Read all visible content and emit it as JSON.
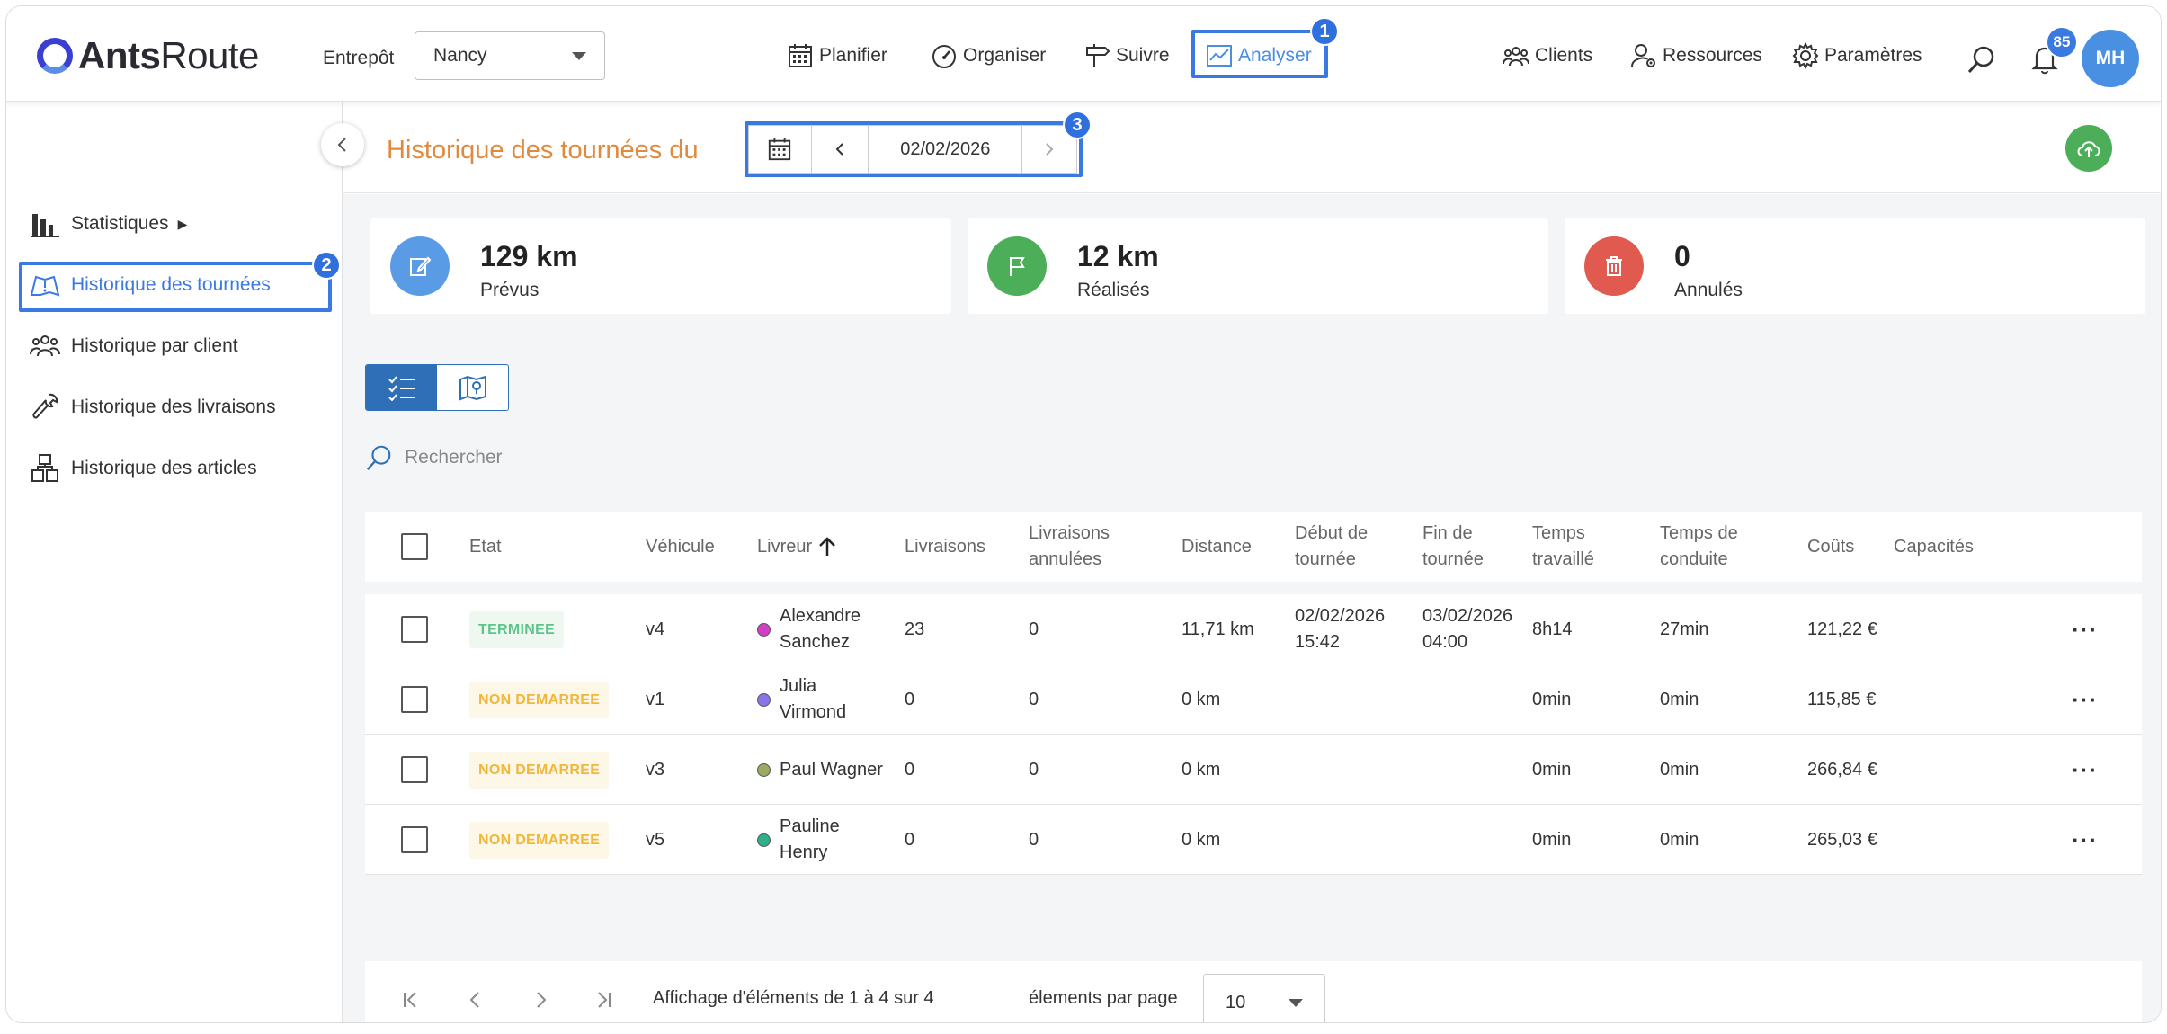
{
  "app": {
    "brand_bold": "Ants",
    "brand_light": "Route"
  },
  "header": {
    "entrepot_label": "Entrepôt",
    "entrepot_value": "Nancy",
    "nav": [
      {
        "label": "Planifier",
        "icon": "calendar-icon"
      },
      {
        "label": "Organiser",
        "icon": "speedometer-icon"
      },
      {
        "label": "Suivre",
        "icon": "signpost-icon"
      },
      {
        "label": "Analyser",
        "icon": "chart-icon",
        "active": true
      }
    ],
    "right_nav": [
      {
        "label": "Clients",
        "icon": "users-icon"
      },
      {
        "label": "Ressources",
        "icon": "user-gear-icon"
      },
      {
        "label": "Paramètres",
        "icon": "gear-icon"
      }
    ],
    "notification_count": "85",
    "avatar_initials": "MH"
  },
  "annotations": {
    "one": "1",
    "two": "2",
    "three": "3"
  },
  "sidebar": {
    "items": [
      {
        "label": "Statistiques",
        "icon": "bar-chart-icon",
        "suffix": "▶"
      },
      {
        "label": "Historique des tournées",
        "icon": "map-icon",
        "active": true
      },
      {
        "label": "Historique par client",
        "icon": "users-icon"
      },
      {
        "label": "Historique des livraisons",
        "icon": "wrench-icon"
      },
      {
        "label": "Historique des articles",
        "icon": "boxes-icon"
      }
    ]
  },
  "page": {
    "title": "Historique des tournées du",
    "date": "02/02/2026"
  },
  "stats": [
    {
      "value": "129 km",
      "label": "Prévus",
      "color": "#5a9be6"
    },
    {
      "value": "12 km",
      "label": "Réalisés",
      "color": "#4cae58"
    },
    {
      "value": "0",
      "label": "Annulés",
      "color": "#e05a4f"
    }
  ],
  "search": {
    "placeholder": "Rechercher"
  },
  "table": {
    "headers": {
      "etat": "Etat",
      "vehicule": "Véhicule",
      "livreur": "Livreur",
      "livraisons": "Livraisons",
      "livraisons_annulees_1": "Livraisons",
      "livraisons_annulees_2": "annulées",
      "distance": "Distance",
      "debut_1": "Début de",
      "debut_2": "tournée",
      "fin_1": "Fin de",
      "fin_2": "tournée",
      "temps_travaille_1": "Temps",
      "temps_travaille_2": "travaillé",
      "temps_conduite_1": "Temps de",
      "temps_conduite_2": "conduite",
      "couts": "Coûts",
      "capacites": "Capacités"
    },
    "rows": [
      {
        "etat": "TERMINEE",
        "vehicule": "v4",
        "livreur_1": "Alexandre",
        "livreur_2": "Sanchez",
        "dot_color": "#d13fc9",
        "livraisons": "23",
        "annulees": "0",
        "distance": "11,71 km",
        "debut_1": "02/02/2026",
        "debut_2": "15:42",
        "fin_1": "03/02/2026",
        "fin_2": "04:00",
        "temps_travaille": "8h14",
        "temps_conduite": "27min",
        "couts": "121,22 €",
        "actions": "···"
      },
      {
        "etat": "NON DEMARREE",
        "vehicule": "v1",
        "livreur_1": "Julia",
        "livreur_2": "Virmond",
        "dot_color": "#8a74e8",
        "livraisons": "0",
        "annulees": "0",
        "distance": "0 km",
        "debut_1": "",
        "debut_2": "",
        "fin_1": "",
        "fin_2": "",
        "temps_travaille": "0min",
        "temps_conduite": "0min",
        "couts": "115,85 €",
        "actions": "···"
      },
      {
        "etat": "NON DEMARREE",
        "vehicule": "v3",
        "livreur_1": "Paul Wagner",
        "livreur_2": "",
        "dot_color": "#9aaa62",
        "livraisons": "0",
        "annulees": "0",
        "distance": "0 km",
        "debut_1": "",
        "debut_2": "",
        "fin_1": "",
        "fin_2": "",
        "temps_travaille": "0min",
        "temps_conduite": "0min",
        "couts": "266,84 €",
        "actions": "···"
      },
      {
        "etat": "NON DEMARREE",
        "vehicule": "v5",
        "livreur_1": "Pauline",
        "livreur_2": "Henry",
        "dot_color": "#2fb08a",
        "livraisons": "0",
        "annulees": "0",
        "distance": "0 km",
        "debut_1": "",
        "debut_2": "",
        "fin_1": "",
        "fin_2": "",
        "temps_travaille": "0min",
        "temps_conduite": "0min",
        "couts": "265,03 €",
        "actions": "···"
      }
    ]
  },
  "pagination": {
    "info": "Affichage d'éléments de 1 à 4 sur 4",
    "per_page_label": "élements par page",
    "per_page_value": "10"
  }
}
